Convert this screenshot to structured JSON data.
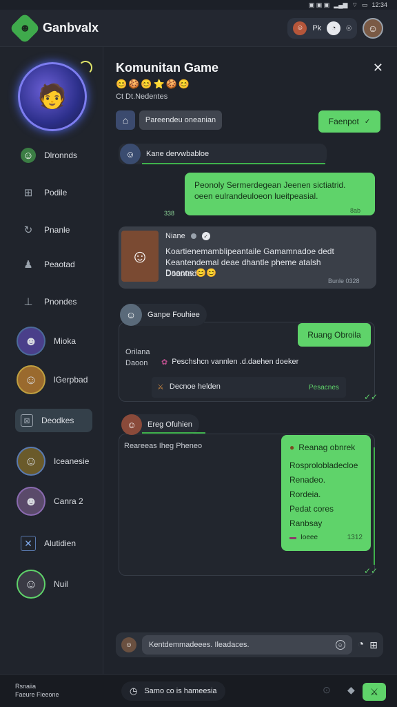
{
  "status": {
    "time": "12:34"
  },
  "header": {
    "app_title": "Ganbvalx",
    "pill_label": "Pk",
    "logo": "game-logo"
  },
  "sidebar": {
    "items": [
      {
        "label": "Dlronnds",
        "icon": "character-icon"
      },
      {
        "label": "Podile",
        "icon": "controller-icon"
      },
      {
        "label": "Pnanle",
        "icon": "refresh-icon"
      },
      {
        "label": "Peaotad",
        "icon": "person-icon"
      },
      {
        "label": "Pnondes",
        "icon": "anvil-icon"
      },
      {
        "label": "Mioka",
        "icon": "avatar"
      },
      {
        "label": "lGerpbad",
        "icon": "avatar"
      },
      {
        "label": "Deodkes",
        "icon": "frame-icon",
        "active": true
      },
      {
        "label": "Iceanesie",
        "icon": "avatar"
      },
      {
        "label": "Canra 2",
        "icon": "avatar"
      },
      {
        "label": "Alutidien",
        "icon": "x-icon"
      },
      {
        "label": "Nuil",
        "icon": "avatar"
      }
    ]
  },
  "chat": {
    "title": "Komunitan Game",
    "emojis": "😊🍪😊⭐🍪😊",
    "subtitle": "Ct Dt.Nedentes",
    "filter_chip": "Pareendeu oneanian",
    "action_button": "Faenpot",
    "thread1_name": "Kane dervwbabloe",
    "msg1_text": "Peonoly Sermerdegean Jeenen sictiatrid. oeen eulrandeuloeon lueitpeasial.",
    "msg1_time_left": "338",
    "msg1_time_right": "8ab",
    "quoted_name": "Niane",
    "quoted_text": "Koartienemamblipeantaile Gamamnadoe dedt Keantendemal deae dhantle pheme atalsh Doantad",
    "quoted_tail": "Dacons 😊😊",
    "quoted_time": "Bunle 0328",
    "group1_name": "Ganpe Fouhiee",
    "group1_btn": "Ruang Obroila",
    "group1_left_top": "Orilana",
    "group1_left_bottom": "Daoon",
    "group1_line1": "Peschshcn vannlen .d.daehen doeker",
    "group1_line2": "Decnoe helden",
    "group1_line2_right": "Pesacnes",
    "group2_name": "Ereg Ofuhien",
    "group2_left": "Reareeas Iheg Pheneo",
    "group2_msg_head": "Reanag obnrek",
    "group2_msg_lines": [
      "Rosprolobladecloe",
      "Renadeo.",
      "Rordeia.",
      "Pedat cores",
      "Ranbsay"
    ],
    "group2_msg_foot": "Ioeee",
    "group2_time": "1312",
    "composer_placeholder": "Kentdemmadeees. Ileadaces."
  },
  "bottom": {
    "left_top": "Rsnaiia",
    "left_bottom": "Faeure Fieeone",
    "center": "Samo co is hameesia"
  },
  "colors": {
    "accent": "#5fd36a",
    "bg": "#1c2028",
    "panel": "#2a2f38"
  }
}
